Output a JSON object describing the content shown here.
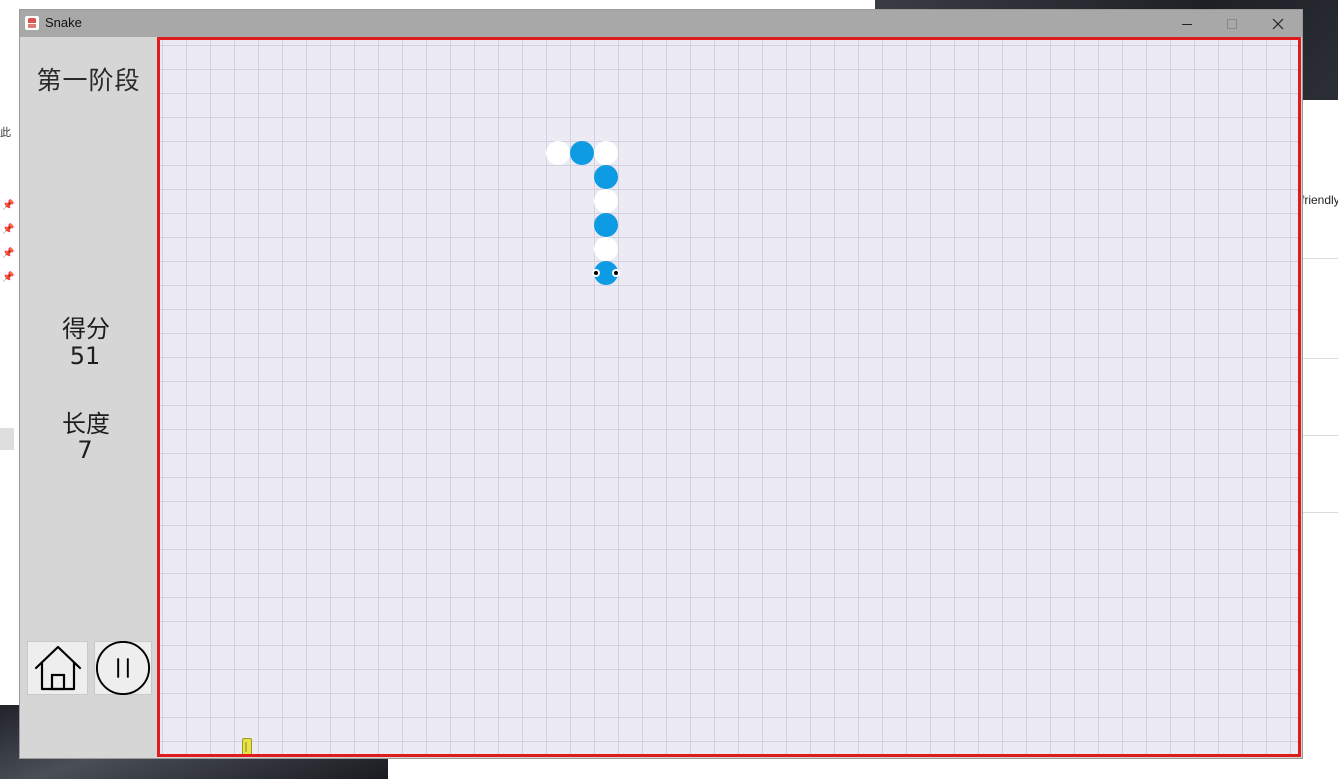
{
  "window": {
    "title": "Snake",
    "minimize_icon": "minimize-icon",
    "maximize_icon": "maximize-icon",
    "close_icon": "close-icon"
  },
  "sidebar": {
    "stage_label": "第一阶段",
    "score_label": "得分",
    "score_value": "51",
    "length_label": "长度",
    "length_value": "7",
    "home_icon": "home-icon",
    "pause_icon": "pause-icon"
  },
  "game": {
    "grid_columns": 47,
    "grid_rows": 30,
    "snake_color": "#0d9be3",
    "snake_alt_color": "#ffffff",
    "border_color": "#e01b1b",
    "board_background": "#ecebf4",
    "snake": [
      {
        "col": 18,
        "row": 9,
        "color": "blue",
        "head": true
      },
      {
        "col": 18,
        "row": 8,
        "color": "white"
      },
      {
        "col": 18,
        "row": 7,
        "color": "blue"
      },
      {
        "col": 18,
        "row": 6,
        "color": "white"
      },
      {
        "col": 18,
        "row": 5,
        "color": "blue"
      },
      {
        "col": 18,
        "row": 4,
        "color": "white"
      },
      {
        "col": 17,
        "row": 4,
        "color": "blue"
      },
      {
        "col": 16,
        "row": 4,
        "color": "white"
      }
    ],
    "food": {
      "col": 3,
      "row": 29
    }
  },
  "background": {
    "right_text": "friendly",
    "left_texts": [
      "此"
    ]
  }
}
